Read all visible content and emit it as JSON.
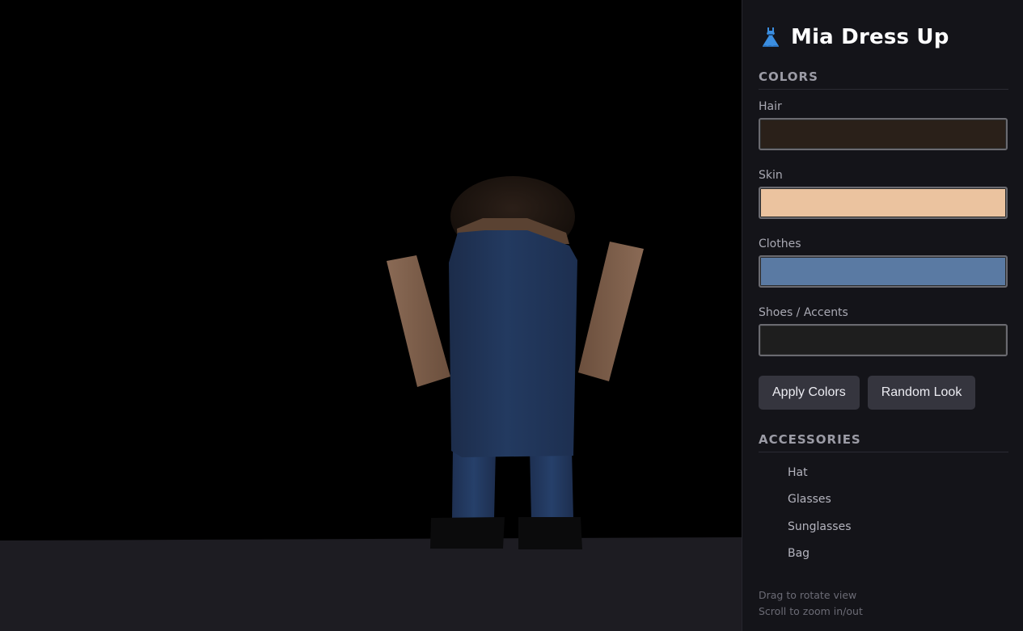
{
  "app": {
    "title": "Mia Dress Up",
    "icon": "dress-icon"
  },
  "colors": {
    "section_title": "COLORS",
    "fields": [
      {
        "label": "Hair",
        "value": "#2a2019"
      },
      {
        "label": "Skin",
        "value": "#ebc39f"
      },
      {
        "label": "Clothes",
        "value": "#5a7aa3"
      },
      {
        "label": "Shoes / Accents",
        "value": "#1e1e1e"
      }
    ]
  },
  "buttons": {
    "apply": "Apply Colors",
    "random": "Random Look"
  },
  "accessories": {
    "section_title": "ACCESSORIES",
    "items": [
      {
        "label": "Hat",
        "checked": false
      },
      {
        "label": "Glasses",
        "checked": false
      },
      {
        "label": "Sunglasses",
        "checked": false
      },
      {
        "label": "Bag",
        "checked": false
      }
    ]
  },
  "hints": {
    "rotate": "Drag to rotate view",
    "zoom": "Scroll to zoom in/out"
  }
}
